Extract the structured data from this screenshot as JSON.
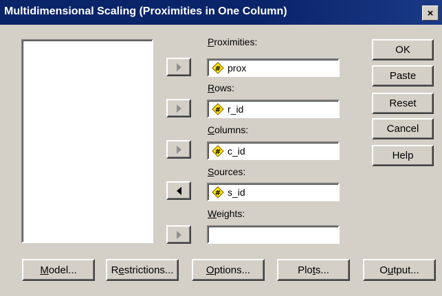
{
  "window": {
    "title": "Multidimensional Scaling (Proximities in One Column)",
    "close_glyph": "×"
  },
  "fields": {
    "proximities": {
      "label_key": "P",
      "label_rest": "roximities:",
      "value": "prox",
      "icon": "numeric-variable-icon"
    },
    "rows": {
      "label_key": "R",
      "label_rest": "ows:",
      "value": "r_id",
      "icon": "numeric-variable-icon"
    },
    "columns": {
      "label_key": "C",
      "label_rest": "olumns:",
      "value": "c_id",
      "icon": "numeric-variable-icon"
    },
    "sources": {
      "label_key": "S",
      "label_rest": "ources:",
      "value": "s_id",
      "icon": "numeric-variable-icon"
    },
    "weights": {
      "label_key": "W",
      "label_rest": "eights:",
      "value": ""
    }
  },
  "side_buttons": {
    "ok": "OK",
    "paste": "Paste",
    "reset": "Reset",
    "cancel": "Cancel",
    "help": "Help"
  },
  "bottom_buttons": {
    "model": {
      "key": "M",
      "rest": "odel..."
    },
    "restrictions": {
      "pre": "R",
      "key": "e",
      "rest": "strictions..."
    },
    "options": {
      "key": "O",
      "rest": "ptions..."
    },
    "plots": {
      "pre": "Plo",
      "key": "t",
      "rest": "s..."
    },
    "output": {
      "pre": "O",
      "key": "u",
      "rest": "tput..."
    }
  },
  "colors": {
    "title_bg": "#0a246a",
    "face": "#d4d0c8",
    "icon_yellow": "#ffe600"
  }
}
